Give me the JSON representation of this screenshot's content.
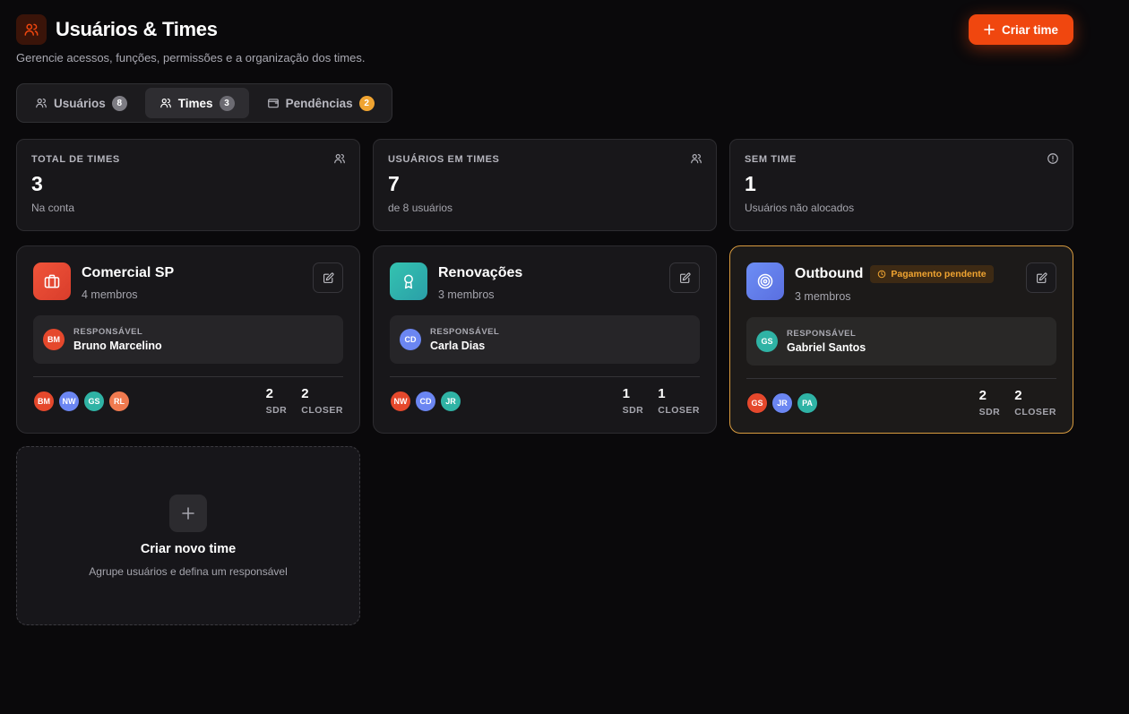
{
  "header": {
    "title": "Usuários & Times",
    "subtitle": "Gerencie acessos, funções, permissões e a organização dos times.",
    "create_button": "Criar time",
    "accent": "#f0470f"
  },
  "tabs": [
    {
      "label": "Usuários",
      "count": "8",
      "active": false
    },
    {
      "label": "Times",
      "count": "3",
      "active": true
    },
    {
      "label": "Pendências",
      "count": "2",
      "active": false
    }
  ],
  "stats": [
    {
      "label": "TOTAL DE TIMES",
      "value": "3",
      "sub": "Na conta",
      "icon": "users-icon"
    },
    {
      "label": "USUÁRIOS EM TIMES",
      "value": "7",
      "sub": "de 8 usuários",
      "icon": "users-icon"
    },
    {
      "label": "SEM TIME",
      "value": "1",
      "sub": "Usuários não alocados",
      "icon": "alert-circle-icon"
    }
  ],
  "teams": [
    {
      "name": "Comercial SP",
      "members": "4 membros",
      "icon": "briefcase-icon",
      "responsible_label": "RESPONSÁVEL",
      "responsible_initials": "BM",
      "responsible_name": "Bruno Marcelino",
      "avatars": [
        "BM",
        "NW",
        "GS",
        "RL"
      ],
      "sdr": "2",
      "sdr_label": "SDR",
      "closer": "2",
      "closer_label": "CLOSER"
    },
    {
      "name": "Renovações",
      "members": "3 membros",
      "icon": "award-icon",
      "responsible_label": "RESPONSÁVEL",
      "responsible_initials": "CD",
      "responsible_name": "Carla Dias",
      "avatars": [
        "NW",
        "CD",
        "JR"
      ],
      "sdr": "1",
      "sdr_label": "SDR",
      "closer": "1",
      "closer_label": "CLOSER"
    },
    {
      "name": "Outbound",
      "members": "3 membros",
      "icon": "target-icon",
      "badge": "Pagamento pendente",
      "responsible_label": "RESPONSÁVEL",
      "responsible_initials": "GS",
      "responsible_name": "Gabriel Santos",
      "avatars": [
        "GS",
        "JR",
        "PA"
      ],
      "sdr": "2",
      "sdr_label": "SDR",
      "closer": "2",
      "closer_label": "CLOSER"
    }
  ],
  "new_team": {
    "title": "Criar novo time",
    "subtitle": "Agrupe usuários e defina um responsável"
  }
}
